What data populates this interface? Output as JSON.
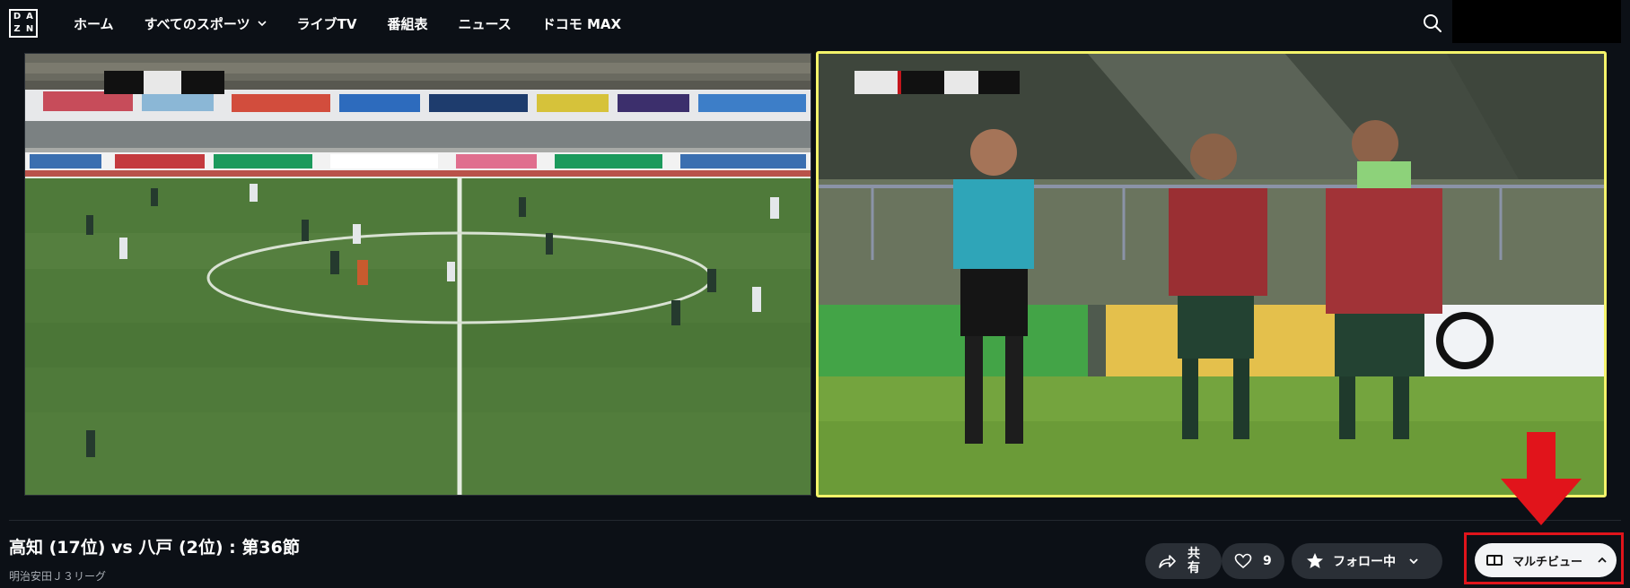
{
  "logo": {
    "letters": [
      "D",
      "A",
      "Z",
      "N"
    ]
  },
  "nav": {
    "items": [
      {
        "label": "ホーム",
        "has_dropdown": false
      },
      {
        "label": "すべてのスポーツ",
        "has_dropdown": true
      },
      {
        "label": "ライブTV",
        "has_dropdown": false
      },
      {
        "label": "番組表",
        "has_dropdown": false
      },
      {
        "label": "ニュース",
        "has_dropdown": false
      },
      {
        "label": "ドコモ MAX",
        "has_dropdown": false
      }
    ],
    "search_icon": "search-icon"
  },
  "player": {
    "left_video": {
      "description_icon": "video-feed"
    },
    "right_video": {
      "active": true,
      "border_color": "#f4f36a"
    }
  },
  "event": {
    "title": "高知 (17位) vs 八戸 (2位) : 第36節",
    "league": "明治安田Ｊ３リーグ"
  },
  "actions": {
    "share_label": "共有",
    "like_count": "9",
    "follow_label": "フォロー中",
    "multiview_label": "マルチビュー"
  },
  "colors": {
    "background": "#0c1016",
    "pill": "#2a2f36",
    "highlight": "#e1141b",
    "active_border": "#f4f36a"
  }
}
